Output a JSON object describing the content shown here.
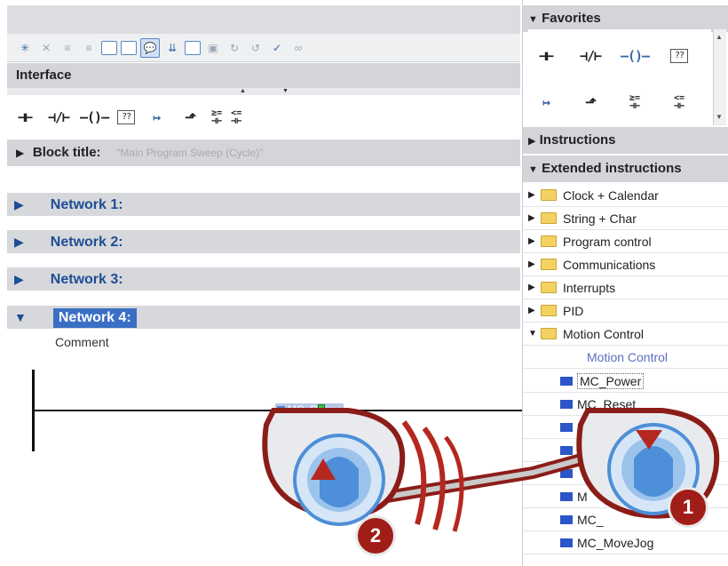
{
  "editor": {
    "interface_label": "Interface",
    "ladder_symbols": [
      "⊣⊢",
      "⊣/⊢",
      "—()—",
      "??",
      "↦",
      "⬏"
    ],
    "compare_ge": "≥=",
    "compare_le": "<=",
    "block_title_label": "Block title:",
    "block_title_value": "\"Main Program Sweep (Cycle)\"",
    "networks": [
      {
        "label": "Network 1:"
      },
      {
        "label": "Network 2:"
      },
      {
        "label": "Network 3:"
      },
      {
        "label": "Network 4:"
      }
    ],
    "comment": "Comment",
    "dragged_block": "MC_Power"
  },
  "panel": {
    "favorites_label": "Favorites",
    "instructions_label": "Instructions",
    "extended_label": "Extended instructions",
    "folders": [
      {
        "label": "Clock + Calendar"
      },
      {
        "label": "String + Char"
      },
      {
        "label": "Program control"
      },
      {
        "label": "Communications"
      },
      {
        "label": "Interrupts"
      },
      {
        "label": "PID"
      },
      {
        "label": "Motion Control"
      }
    ],
    "motion_control_title": "Motion Control",
    "motion_items": [
      {
        "label": "MC_Power"
      },
      {
        "label": "MC_Reset"
      },
      {
        "label": ""
      },
      {
        "label": ""
      },
      {
        "label": ""
      },
      {
        "label": "M"
      },
      {
        "label": "MC_"
      },
      {
        "label": "MC_MoveJog"
      }
    ]
  },
  "callouts": {
    "step1": "1",
    "step2": "2"
  },
  "colors": {
    "network_blue": "#1e4c96",
    "selected_blue": "#3a6fc4",
    "callout_red": "#b5271f",
    "callout_blue": "#4d8fd8"
  }
}
